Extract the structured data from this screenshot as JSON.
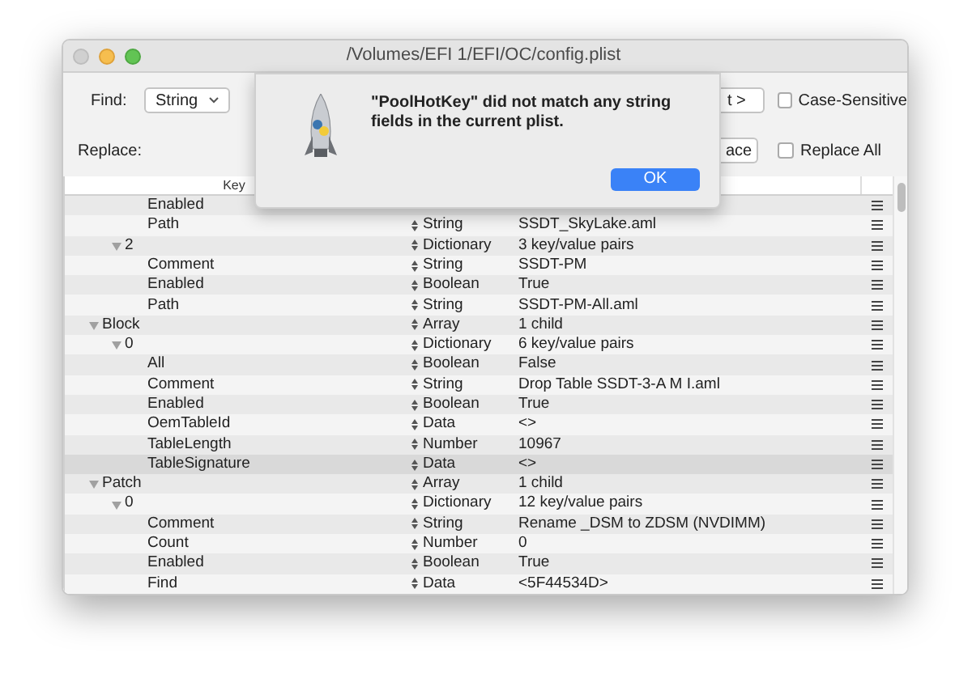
{
  "window": {
    "title": "/Volumes/EFI 1/EFI/OC/config.plist"
  },
  "find_bar": {
    "find_label": "Find:",
    "find_type": "String",
    "find_next_button": "t >",
    "case_sensitive": {
      "label": "Case-Sensitive",
      "checked": false
    },
    "replace_label": "Replace:",
    "replace_button": "ace",
    "replace_all": {
      "label": "Replace All",
      "checked": false
    }
  },
  "table": {
    "columns": [
      "Key"
    ],
    "outline": [
      {
        "children": [
          {
            "children": [
              {
                "key": "Enabled",
                "selected": false
              },
              {
                "key": "Path",
                "type": "String",
                "value": "SSDT_SkyLake.aml",
                "selected": false
              }
            ]
          },
          {
            "key": "2",
            "type": "Dictionary",
            "value": "3 key/value pairs",
            "expanded": true,
            "selected": false,
            "children": [
              {
                "key": "Comment",
                "type": "String",
                "value": "SSDT-PM",
                "selected": false
              },
              {
                "key": "Enabled",
                "type": "Boolean",
                "value": "True",
                "selected": false
              },
              {
                "key": "Path",
                "type": "String",
                "value": "SSDT-PM-All.aml",
                "selected": false
              }
            ]
          }
        ]
      },
      {
        "key": "Block",
        "type": "Array",
        "value": "1 child",
        "expanded": true,
        "selected": false,
        "children": [
          {
            "key": "0",
            "type": "Dictionary",
            "value": "6 key/value pairs",
            "expanded": true,
            "selected": false,
            "children": [
              {
                "key": "All",
                "type": "Boolean",
                "value": "False",
                "selected": false
              },
              {
                "key": "Comment",
                "type": "String",
                "value": "Drop Table SSDT-3-A M I.aml",
                "selected": false
              },
              {
                "key": "Enabled",
                "type": "Boolean",
                "value": "True",
                "selected": false
              },
              {
                "key": "OemTableId",
                "type": "Data",
                "value": "<>",
                "selected": false
              },
              {
                "key": "TableLength",
                "type": "Number",
                "value": "10967",
                "selected": false
              },
              {
                "key": "TableSignature",
                "type": "Data",
                "value": "<>",
                "selected": true
              }
            ]
          }
        ]
      },
      {
        "key": "Patch",
        "type": "Array",
        "value": "1 child",
        "expanded": true,
        "selected": false,
        "children": [
          {
            "key": "0",
            "type": "Dictionary",
            "value": "12 key/value pairs",
            "expanded": true,
            "selected": false,
            "children": [
              {
                "key": "Comment",
                "type": "String",
                "value": "Rename _DSM to ZDSM (NVDIMM)",
                "selected": false
              },
              {
                "key": "Count",
                "type": "Number",
                "value": "0",
                "selected": false
              },
              {
                "key": "Enabled",
                "type": "Boolean",
                "value": "True",
                "selected": false
              },
              {
                "key": "Find",
                "type": "Data",
                "value": "<5F44534D>",
                "selected": false
              }
            ]
          }
        ]
      }
    ]
  },
  "alert": {
    "message": "\"PoolHotKey\" did not match any string fields in the current plist.",
    "button": "OK"
  }
}
